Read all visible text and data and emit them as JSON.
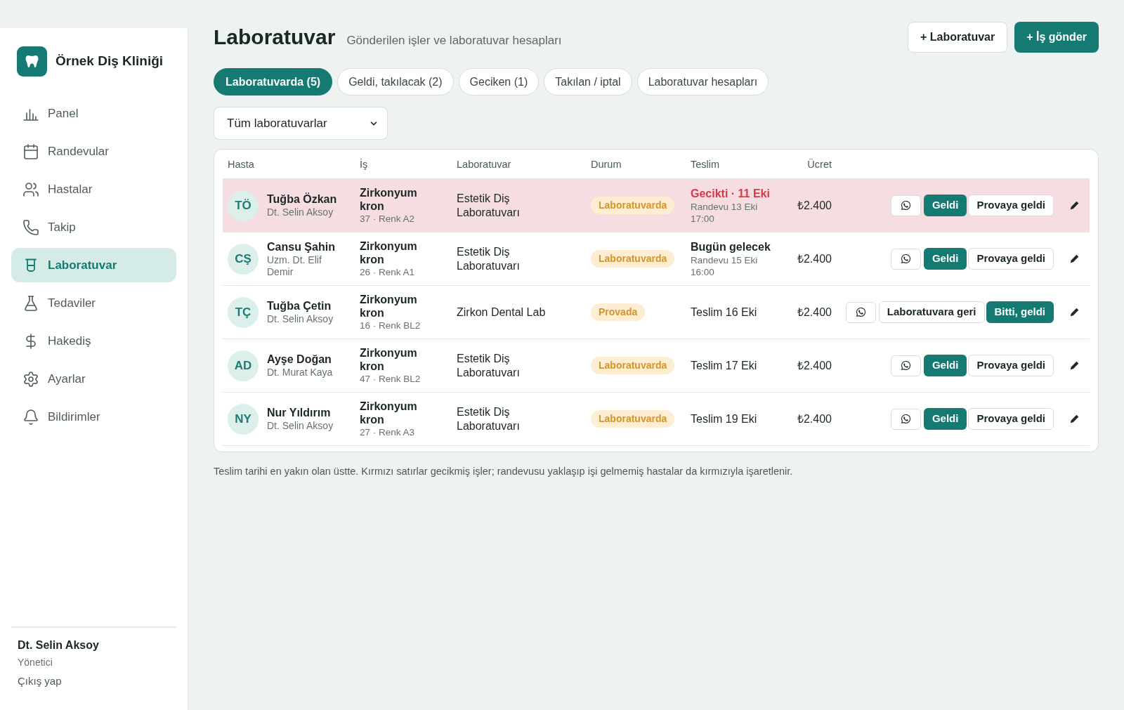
{
  "sidebar": {
    "clinic_name": "Örnek Diş Kliniği",
    "nav_items": [
      {
        "label": "Panel",
        "selected": false
      },
      {
        "label": "Randevular",
        "selected": false
      },
      {
        "label": "Hastalar",
        "selected": false
      },
      {
        "label": "Takip",
        "selected": false
      },
      {
        "label": "Laboratuvar",
        "selected": true
      },
      {
        "label": "Tedaviler",
        "selected": false
      },
      {
        "label": "Hakediş",
        "selected": false
      },
      {
        "label": "Ayarlar",
        "selected": false
      },
      {
        "label": "Bildirimler",
        "selected": false
      }
    ],
    "user": {
      "name": "Dt. Selin Aksoy",
      "role": "Yönetici",
      "logout": "Çıkış yap"
    }
  },
  "header": {
    "title": "Laboratuvar",
    "subtitle": "Gönderilen işler ve laboratuvar hesapları",
    "buttons": [
      {
        "label": "+ Laboratuvar",
        "kind": "outline"
      },
      {
        "label": "+ İş gönder",
        "kind": "primary"
      }
    ]
  },
  "tabs": [
    {
      "label": "Laboratuvarda (5)",
      "selected": true
    },
    {
      "label": "Geldi, takılacak (2)",
      "selected": false
    },
    {
      "label": "Geciken (1)",
      "selected": false
    },
    {
      "label": "Takılan / iptal",
      "selected": false
    },
    {
      "label": "Laboratuvar hesapları",
      "selected": false
    }
  ],
  "filter": {
    "value": "Tüm laboratuvarlar"
  },
  "table": {
    "columns": [
      "Hasta",
      "İş",
      "Laboratuvar",
      "Durum",
      "Teslim",
      "Ücret"
    ],
    "rows": [
      {
        "highlighted": true,
        "initials": "TÖ",
        "patient": "Tuğba Özkan",
        "doctor": "Dt. Selin Aksoy",
        "job": "Zirkonyum kron",
        "job_detail": "37 · Renk A2",
        "lab": "Estetik Diş Laboratuvarı",
        "status": "Laboratuvarda",
        "delivery": {
          "kind": "late",
          "text": "Gecikti · 11 Eki",
          "note": "Randevu 13 Eki 17:00"
        },
        "fee": "₺2.400",
        "actions": [
          {
            "kind": "message"
          },
          {
            "kind": "primary",
            "label": "Geldi"
          },
          {
            "kind": "outline",
            "label": "Provaya geldi"
          }
        ]
      },
      {
        "highlighted": false,
        "initials": "CŞ",
        "patient": "Cansu Şahin",
        "doctor": "Uzm. Dt. Elif Demir",
        "job": "Zirkonyum kron",
        "job_detail": "26 · Renk A1",
        "lab": "Estetik Diş Laboratuvarı",
        "status": "Laboratuvarda",
        "delivery": {
          "kind": "soon",
          "text": "Bugün gelecek",
          "note": "Randevu 15 Eki 16:00"
        },
        "fee": "₺2.400",
        "actions": [
          {
            "kind": "message"
          },
          {
            "kind": "primary",
            "label": "Geldi"
          },
          {
            "kind": "outline",
            "label": "Provaya geldi"
          }
        ]
      },
      {
        "highlighted": false,
        "initials": "TÇ",
        "patient": "Tuğba Çetin",
        "doctor": "Dt. Selin Aksoy",
        "job": "Zirkonyum kron",
        "job_detail": "16 · Renk BL2",
        "lab": "Zirkon Dental Lab",
        "status": "Provada",
        "delivery": {
          "kind": "normal",
          "text": "Teslim 16 Eki"
        },
        "fee": "₺2.400",
        "actions": [
          {
            "kind": "message"
          },
          {
            "kind": "outline",
            "label": "Laboratuvara geri"
          },
          {
            "kind": "primary",
            "label": "Bitti, geldi"
          }
        ]
      },
      {
        "highlighted": false,
        "initials": "AD",
        "patient": "Ayşe Doğan",
        "doctor": "Dt. Murat Kaya",
        "job": "Zirkonyum kron",
        "job_detail": "47 · Renk BL2",
        "lab": "Estetik Diş Laboratuvarı",
        "status": "Laboratuvarda",
        "delivery": {
          "kind": "normal",
          "text": "Teslim 17 Eki"
        },
        "fee": "₺2.400",
        "actions": [
          {
            "kind": "message"
          },
          {
            "kind": "primary",
            "label": "Geldi"
          },
          {
            "kind": "outline",
            "label": "Provaya geldi"
          }
        ]
      },
      {
        "highlighted": false,
        "initials": "NY",
        "patient": "Nur Yıldırım",
        "doctor": "Dt. Selin Aksoy",
        "job": "Zirkonyum kron",
        "job_detail": "27 · Renk A3",
        "lab": "Estetik Diş Laboratuvarı",
        "status": "Laboratuvarda",
        "delivery": {
          "kind": "normal",
          "text": "Teslim 19 Eki"
        },
        "fee": "₺2.400",
        "actions": [
          {
            "kind": "message"
          },
          {
            "kind": "primary",
            "label": "Geldi"
          },
          {
            "kind": "outline",
            "label": "Provaya geldi"
          }
        ]
      }
    ]
  },
  "footnote": "Teslim tarihi en yakın olan üstte. Kırmızı satırlar gecikmiş işler; randevusu yaklaşıp işi gelmemiş hastalar da kırmızıyla işaretlenir."
}
